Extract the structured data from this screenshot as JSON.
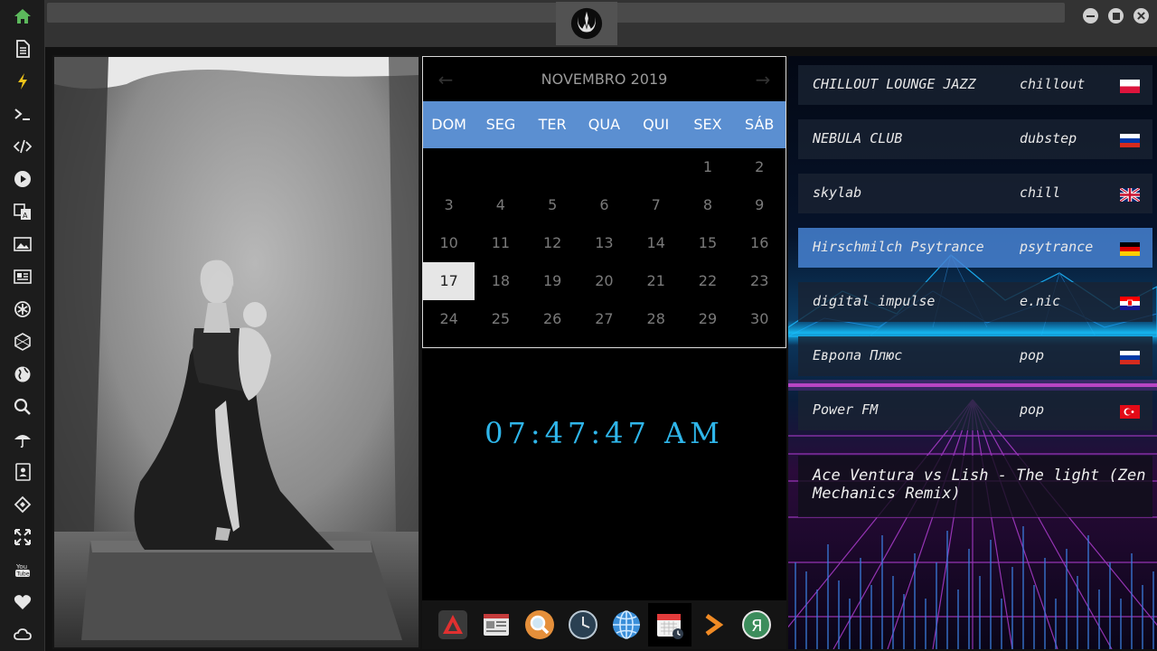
{
  "sidebar": {
    "icons": [
      "home-icon",
      "document-icon",
      "lightning-icon",
      "terminal-icon",
      "code-icon",
      "play-icon",
      "translate-icon",
      "image-icon",
      "news-icon",
      "settings-icon",
      "hexagon-icon",
      "globe-icon",
      "search-icon",
      "umbrella-icon",
      "contacts-icon",
      "tag-icon",
      "fullscreen-icon",
      "youtube-icon",
      "heart-icon",
      "cloud-icon"
    ]
  },
  "window": {
    "emblem": "rebel-alliance-icon"
  },
  "calendar": {
    "title": "NOVEMBRO 2019",
    "prev": "←",
    "next": "→",
    "weekdays": [
      "DOM",
      "SEG",
      "TER",
      "QUA",
      "QUI",
      "SEX",
      "SÁB"
    ],
    "weeks": [
      [
        "",
        "",
        "",
        "",
        "",
        "1",
        "2"
      ],
      [
        "3",
        "4",
        "5",
        "6",
        "7",
        "8",
        "9"
      ],
      [
        "10",
        "11",
        "12",
        "13",
        "14",
        "15",
        "16"
      ],
      [
        "17",
        "18",
        "19",
        "20",
        "21",
        "22",
        "23"
      ],
      [
        "24",
        "25",
        "26",
        "27",
        "28",
        "29",
        "30"
      ]
    ],
    "today": "17"
  },
  "clock": {
    "time": "07:47:47 AM"
  },
  "dock": {
    "items": [
      "arch-icon",
      "news-reader-icon",
      "search-app-icon",
      "clock-app-icon",
      "browser-icon",
      "calendar-app-icon",
      "terminal-arrow-icon",
      "yandex-icon"
    ],
    "active": "calendar-app-icon"
  },
  "radio": {
    "stations": [
      {
        "name": "CHILLOUT LOUNGE JAZZ",
        "genre": "chillout",
        "flag": "poland"
      },
      {
        "name": "NEBULA CLUB",
        "genre": "dubstep",
        "flag": "russia"
      },
      {
        "name": "skylab",
        "genre": "chill",
        "flag": "uk"
      },
      {
        "name": "Hirschmilch Psytrance",
        "genre": "psytrance",
        "flag": "germany"
      },
      {
        "name": "digital impulse",
        "genre": "e.nic",
        "flag": "croatia"
      },
      {
        "name": "Европа Плюс",
        "genre": "pop",
        "flag": "russia"
      },
      {
        "name": "Power FM",
        "genre": "pop",
        "flag": "turkey"
      }
    ],
    "active_station": "Hirschmilch Psytrance",
    "now_playing": "Ace Ventura vs Lish - The light (Zen Mechanics Remix)"
  },
  "colors": {
    "accent": "#5b8fd1",
    "clock": "#2fb6ea",
    "sidebar_home": "#5cb85c",
    "sidebar_bolt": "#f0c419"
  }
}
